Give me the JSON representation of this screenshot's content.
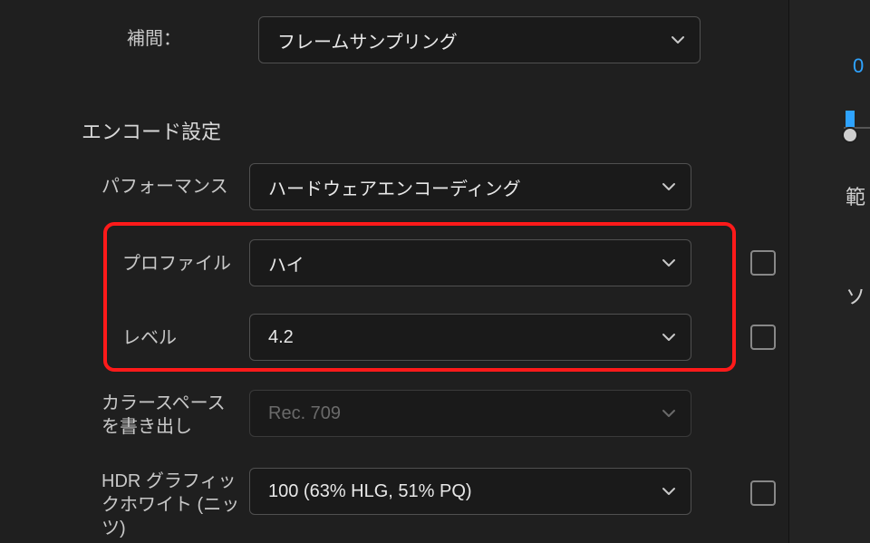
{
  "interpolation": {
    "label": "補間：",
    "value": "フレームサンプリング"
  },
  "encode": {
    "section": "エンコード設定",
    "performance": {
      "label": "パフォーマンス",
      "value": "ハードウェアエンコーディング"
    },
    "profile": {
      "label": "プロファイル",
      "value": "ハイ"
    },
    "level": {
      "label": "レベル",
      "value": "4.2"
    },
    "colorspace": {
      "label": "カラースペースを書き出し",
      "value": "Rec. 709"
    },
    "hdrwhite": {
      "label": "HDR グラフィックホワイト (ニッツ)",
      "value": "100 (63% HLG, 51% PQ)"
    }
  },
  "side": {
    "zero": "0",
    "han": "範",
    "so": "ソ"
  }
}
